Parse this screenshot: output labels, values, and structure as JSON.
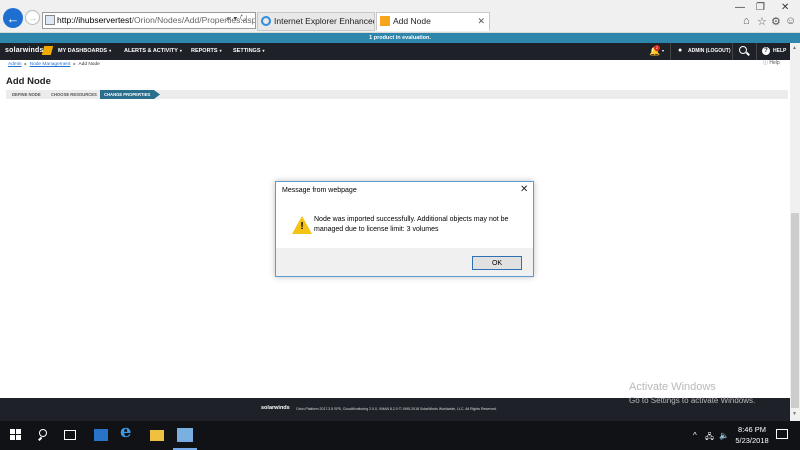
{
  "browser": {
    "address_host": "http://ihubservertest",
    "address_path": "/Orion/Nodes/Add/Properties.asp",
    "address_tools": "⌕ ▾ ↻",
    "tabs": [
      {
        "label": "Internet Explorer Enhanced Sec..."
      },
      {
        "label": "Add Node"
      }
    ],
    "tab_close": "✕",
    "window_controls": [
      "—",
      "❐",
      "✕"
    ],
    "toolbar_icons": [
      "⌂",
      "☆",
      "⚙",
      "☺"
    ]
  },
  "eval_banner": "1 product in evaluation.",
  "nav": {
    "logo": "solarwinds",
    "items": [
      {
        "label": "MY DASHBOARDS"
      },
      {
        "label": "ALERTS & ACTIVITY"
      },
      {
        "label": "REPORTS"
      },
      {
        "label": "SETTINGS"
      }
    ],
    "caret": "▾",
    "bell": "🔔",
    "badge": "2",
    "admin": "ADMIN (LOGOUT)",
    "help": "HELP",
    "help_glyph": "?"
  },
  "breadcrumb": {
    "items": [
      "Admin",
      "Node Management",
      "Add Node"
    ],
    "arrow": "▸"
  },
  "help_link": "Help",
  "page_title": "Add Node",
  "steps": [
    "DEFINE NODE",
    "CHOOSE RESOURCES",
    "CHANGE PROPERTIES"
  ],
  "footer": {
    "logo": "solarwinds",
    "text": "Orion Platform 2017.3.5 SP5, CloudMonitoring 2.0.0, VMAN 8.2.0 © 1995-2018 SolarWinds Worldwide, LLC. All Rights Reserved."
  },
  "watermark": {
    "line1": "Activate Windows",
    "line2": "Go to Settings to activate Windows."
  },
  "dialog": {
    "title": "Message from webpage",
    "close": "✕",
    "warn": "!",
    "message": "Node was imported successfully. Additional objects may not be managed due to license limit: 3 volumes",
    "ok_label": "OK"
  },
  "taskbar": {
    "ie": "e",
    "tray_arrow": "^",
    "tray_icons": [
      "🖧",
      "🔈"
    ],
    "time": "8:46 PM",
    "date": "5/23/2018"
  }
}
